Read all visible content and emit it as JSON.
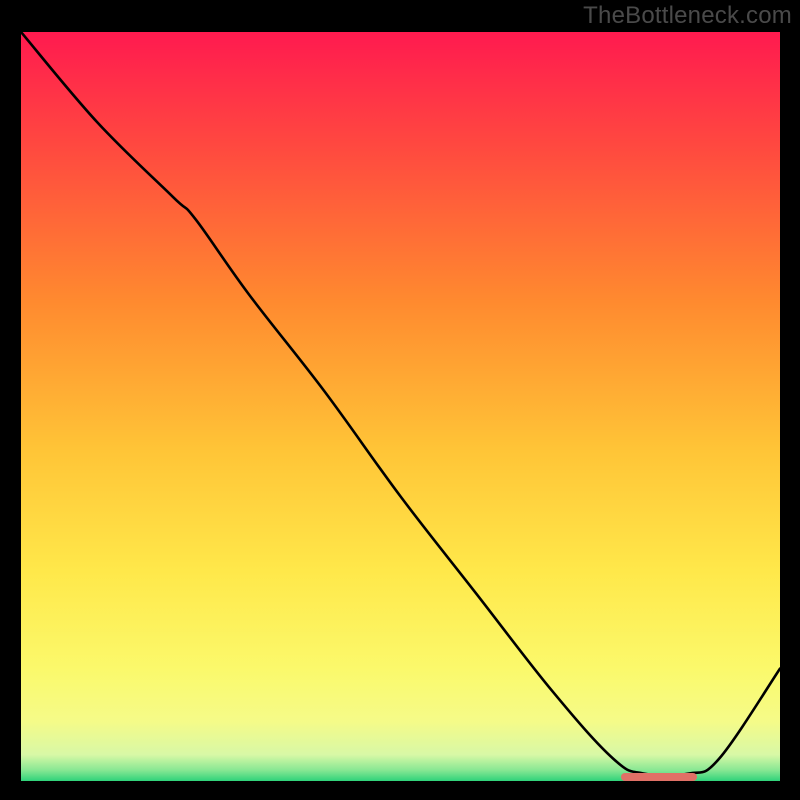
{
  "watermark": "TheBottleneck.com",
  "colors": {
    "black": "#000000",
    "marker": "#e07066",
    "gradient_stops": [
      {
        "o": 0.0,
        "c": "#ff1a4f"
      },
      {
        "o": 0.16,
        "c": "#ff4b3f"
      },
      {
        "o": 0.36,
        "c": "#ff8a2f"
      },
      {
        "o": 0.56,
        "c": "#ffc537"
      },
      {
        "o": 0.72,
        "c": "#ffe84a"
      },
      {
        "o": 0.85,
        "c": "#fbf96b"
      },
      {
        "o": 0.92,
        "c": "#f5fb88"
      },
      {
        "o": 0.965,
        "c": "#d8f8a6"
      },
      {
        "o": 0.985,
        "c": "#8ae894"
      },
      {
        "o": 1.0,
        "c": "#2fd27a"
      }
    ]
  },
  "chart_data": {
    "type": "line",
    "title": "",
    "xlabel": "",
    "ylabel": "",
    "x": [
      0.0,
      0.1,
      0.2,
      0.23,
      0.3,
      0.4,
      0.5,
      0.6,
      0.7,
      0.78,
      0.82,
      0.88,
      0.92,
      1.0
    ],
    "values": [
      1.0,
      0.88,
      0.78,
      0.75,
      0.65,
      0.52,
      0.38,
      0.25,
      0.12,
      0.03,
      0.01,
      0.01,
      0.03,
      0.15
    ],
    "ylim": [
      0.0,
      1.0
    ],
    "xlim": [
      0.0,
      1.0
    ],
    "note": "Single line on red→green vertical gradient background; valley near x≈0.82–0.88.",
    "marker": {
      "x_start": 0.79,
      "x_end": 0.89,
      "y": 0.005
    }
  }
}
